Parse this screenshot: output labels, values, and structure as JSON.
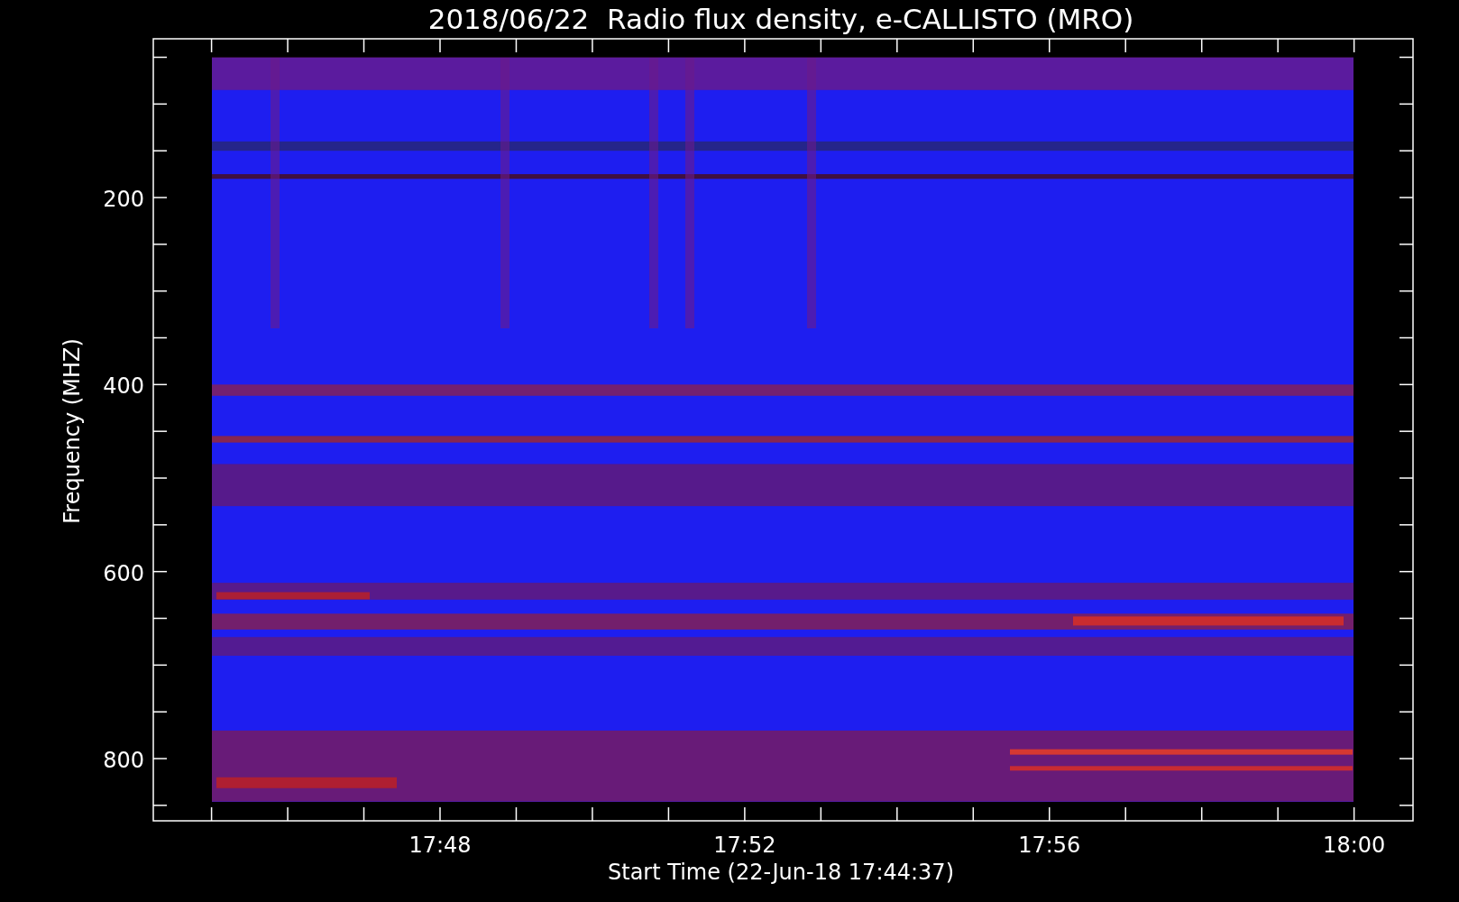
{
  "title": "2018/06/22  Radio flux density, e-CALLISTO (MRO)",
  "y_axis": {
    "label": "Frequency (MHZ)",
    "ticks": [
      "200",
      "400",
      "600",
      "800"
    ]
  },
  "x_axis": {
    "label": "Start Time (22-Jun-18 17:44:37)",
    "ticks": [
      "17:48",
      "17:52",
      "17:56",
      "18:00"
    ]
  }
}
